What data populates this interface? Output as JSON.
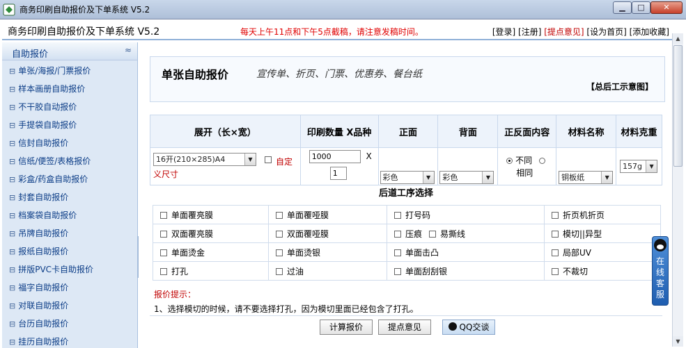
{
  "window": {
    "title": "商务印刷自助报价及下单系统 V5.2",
    "min": "▁",
    "max": "□",
    "close": "✕"
  },
  "header": {
    "app_title": "商务印刷自助报价及下单系统  V5.2",
    "notice": "每天上午11点和下午5点截稿，请注意发稿时间。",
    "links": [
      "[登录]",
      "[注册]",
      "[提点意见]",
      "[设为首页]",
      "[添加收藏]"
    ]
  },
  "sidebar": {
    "title": "自助报价",
    "collapse": "≈",
    "items": [
      "单张/海报/门票报价",
      "样本画册自助报价",
      "不干胶自动报价",
      "手提袋自助报价",
      "信封自助报价",
      "信纸/便签/表格报价",
      "彩盒/药盒自助报价",
      "封套自助报价",
      "档案袋自助报价",
      "吊牌自助报价",
      "报纸自助报价",
      "拼版PVC卡自助报价",
      "福字自助报价",
      "对联自助报价",
      "台历自助报价",
      "挂历自助报价"
    ]
  },
  "banner": {
    "title": "单张自助报价",
    "subtitle": "宣传单、折页、门票、优惠券、餐台纸",
    "link": "【总后工示意图】"
  },
  "form": {
    "headers": [
      "展开（长×宽）",
      "印刷数量 X品种",
      "正面",
      "背面",
      "正反面内容",
      "材料名称",
      "材料克重"
    ],
    "size_select": "16开(210×285)A4",
    "custom_size_label": "自定义尺寸",
    "quantity": "1000",
    "times": "X",
    "kinds": "1",
    "front_select": "彩色",
    "back_select": "彩色",
    "radio_diff": "不同",
    "radio_same": "相同",
    "material_select": "铜板纸",
    "weight_select": "157g"
  },
  "post": {
    "title": "后道工序选择",
    "rows": [
      [
        "单面覆亮膜",
        "单面覆哑膜",
        "打号码",
        "折页机折页"
      ],
      [
        "双面覆亮膜",
        "双面覆哑膜",
        "压痕",
        "模切||异型"
      ],
      [
        "单面烫金",
        "单面烫银",
        "单面击凸",
        "局部UV"
      ],
      [
        "打孔",
        "过油",
        "单面刮刮银",
        "不裁切"
      ]
    ],
    "extra": "易撕线"
  },
  "tips": {
    "title": "报价提示：",
    "text": "1、选择模切的时候，请不要选择打孔，因为模切里面已经包含了打孔。"
  },
  "buttons": {
    "calc": "计算报价",
    "feedback": "提点意见",
    "qq": "QQ交谈"
  },
  "service": {
    "label": "在线客服"
  },
  "colors": {
    "accent": "#0b3c86",
    "red": "#e00000",
    "border": "#c9d8ec"
  }
}
